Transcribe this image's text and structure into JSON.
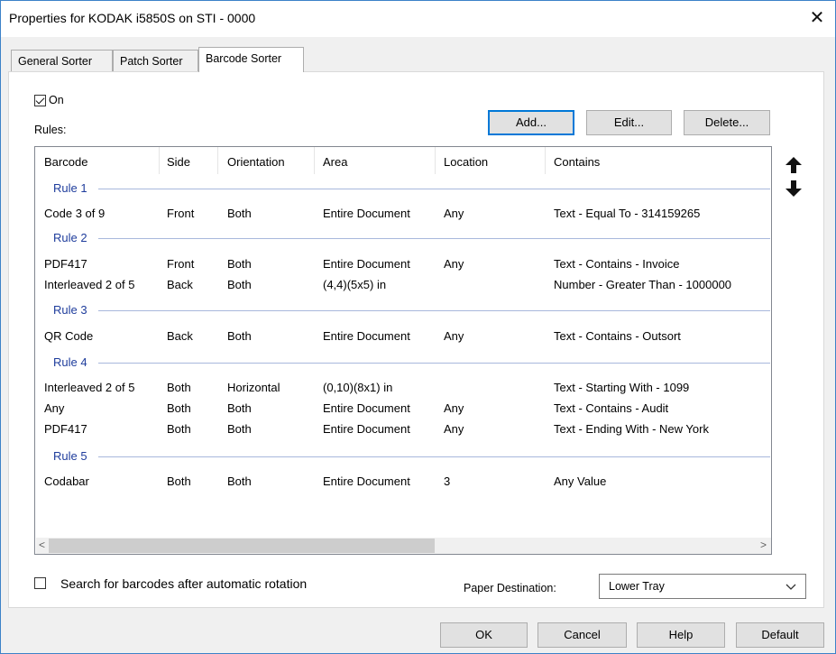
{
  "window": {
    "title": "Properties for KODAK i5850S on STI - 0000",
    "close_glyph": "✕"
  },
  "tabs": [
    {
      "label": "General Sorter"
    },
    {
      "label": "Patch Sorter"
    },
    {
      "label": "Barcode Sorter"
    }
  ],
  "on_checkbox": {
    "label": "On",
    "checked": true
  },
  "rules_label": "Rules:",
  "buttons": {
    "add": "Add...",
    "edit": "Edit...",
    "delete": "Delete..."
  },
  "columns": [
    "Barcode",
    "Side",
    "Orientation",
    "Area",
    "Location",
    "Contains"
  ],
  "rules": [
    {
      "name": "Rule 1",
      "rows": [
        {
          "barcode": "Code 3 of 9",
          "side": "Front",
          "orientation": "Both",
          "area": "Entire Document",
          "location": "Any",
          "contains": "Text - Equal To - 314159265"
        }
      ]
    },
    {
      "name": "Rule 2",
      "rows": [
        {
          "barcode": "PDF417",
          "side": "Front",
          "orientation": "Both",
          "area": "Entire Document",
          "location": "Any",
          "contains": "Text - Contains - Invoice"
        },
        {
          "barcode": "Interleaved 2 of 5",
          "side": "Back",
          "orientation": "Both",
          "area": "(4,4)(5x5) in",
          "location": "",
          "contains": "Number - Greater Than - 1000000"
        }
      ]
    },
    {
      "name": "Rule 3",
      "rows": [
        {
          "barcode": "QR Code",
          "side": "Back",
          "orientation": "Both",
          "area": "Entire Document",
          "location": "Any",
          "contains": "Text - Contains - Outsort"
        }
      ]
    },
    {
      "name": "Rule 4",
      "rows": [
        {
          "barcode": "Interleaved 2 of 5",
          "side": "Both",
          "orientation": "Horizontal",
          "area": "(0,10)(8x1) in",
          "location": "",
          "contains": "Text - Starting With - 1099"
        },
        {
          "barcode": "Any",
          "side": "Both",
          "orientation": "Both",
          "area": "Entire Document",
          "location": "Any",
          "contains": "Text - Contains - Audit"
        },
        {
          "barcode": "PDF417",
          "side": "Both",
          "orientation": "Both",
          "area": "Entire Document",
          "location": "Any",
          "contains": "Text - Ending With - New York"
        }
      ]
    },
    {
      "name": "Rule 5",
      "rows": [
        {
          "barcode": "Codabar",
          "side": "Both",
          "orientation": "Both",
          "area": "Entire Document",
          "location": "3",
          "contains": "Any Value"
        }
      ]
    }
  ],
  "scrollbar": {
    "left_glyph": "<",
    "right_glyph": ">"
  },
  "search_checkbox": {
    "label": "Search for barcodes after automatic rotation",
    "checked": false
  },
  "paper_destination": {
    "label": "Paper Destination:",
    "value": "Lower Tray"
  },
  "footer_buttons": {
    "ok": "OK",
    "cancel": "Cancel",
    "help": "Help",
    "default": "Default"
  },
  "colors": {
    "accent": "#0078d7",
    "group_text": "#1e3c9c"
  }
}
